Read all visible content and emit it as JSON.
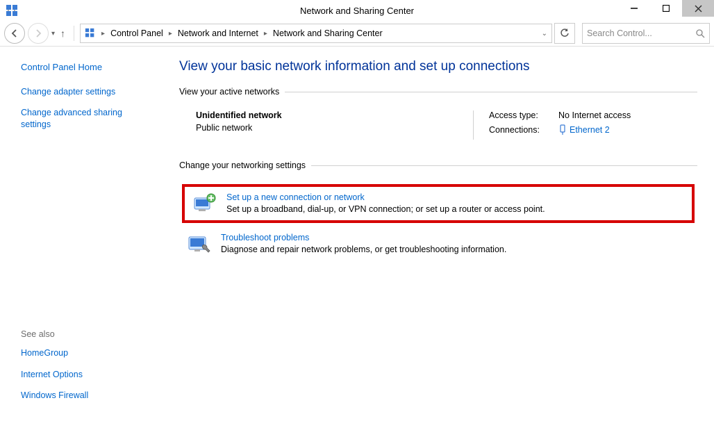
{
  "window": {
    "title": "Network and Sharing Center"
  },
  "breadcrumbs": {
    "items": [
      "Control Panel",
      "Network and Internet",
      "Network and Sharing Center"
    ]
  },
  "search": {
    "placeholder": "Search Control..."
  },
  "sidebar": {
    "home": "Control Panel Home",
    "links": [
      "Change adapter settings",
      "Change advanced sharing settings"
    ],
    "see_also_label": "See also",
    "see_also": [
      "HomeGroup",
      "Internet Options",
      "Windows Firewall"
    ]
  },
  "main": {
    "heading": "View your basic network information and set up connections",
    "active_label": "View your active networks",
    "network": {
      "name": "Unidentified network",
      "type": "Public network",
      "access_label": "Access type:",
      "access_value": "No Internet access",
      "conn_label": "Connections:",
      "conn_value": "Ethernet 2"
    },
    "change_label": "Change your networking settings",
    "tasks": [
      {
        "title": "Set up a new connection or network",
        "desc": "Set up a broadband, dial-up, or VPN connection; or set up a router or access point.",
        "highlight": true
      },
      {
        "title": "Troubleshoot problems",
        "desc": "Diagnose and repair network problems, or get troubleshooting information.",
        "highlight": false
      }
    ]
  }
}
